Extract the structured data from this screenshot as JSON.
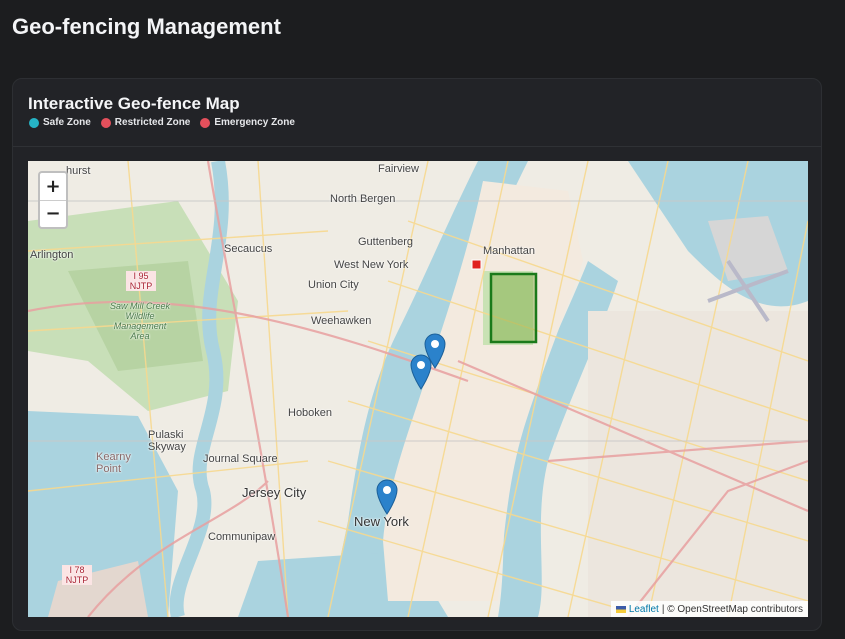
{
  "page": {
    "title": "Geo-fencing Management"
  },
  "card": {
    "title": "Interactive Geo-fence Map",
    "legend": [
      {
        "label": "Safe Zone",
        "color": "#26b4c6"
      },
      {
        "label": "Restricted Zone",
        "color": "#e4505c"
      },
      {
        "label": "Emergency Zone",
        "color": "#e4505c"
      }
    ]
  },
  "map": {
    "zoom_in_label": "+",
    "zoom_out_label": "−",
    "attribution_link": "Leaflet",
    "attribution_text": "| © OpenStreetMap contributors",
    "place_labels": {
      "fairview": "Fairview",
      "north_bergen": "North Bergen",
      "secaucus": "Secaucus",
      "guttenberg": "Guttenberg",
      "manhattan": "Manhattan",
      "arlington": "Arlington",
      "west_new_york": "West New York",
      "union_city": "Union City",
      "weehawken": "Weehawken",
      "hoboken": "Hoboken",
      "pulaski_skyway": "Pulaski Skyway",
      "journal_square": "Journal Square",
      "jersey_city": "Jersey City",
      "communipaw": "Communipaw",
      "new_york": "New York",
      "kearny_point": "Kearny Point",
      "hurst": "hurst",
      "njtp_top": "I 95 NJTP",
      "njtp_bottom": "I 78 NJTP",
      "saw_mill": "Saw Mill Creek Wildlife Management Area"
    },
    "zone_color": "#1a7a1a",
    "marker_color": "#2b82cb"
  }
}
